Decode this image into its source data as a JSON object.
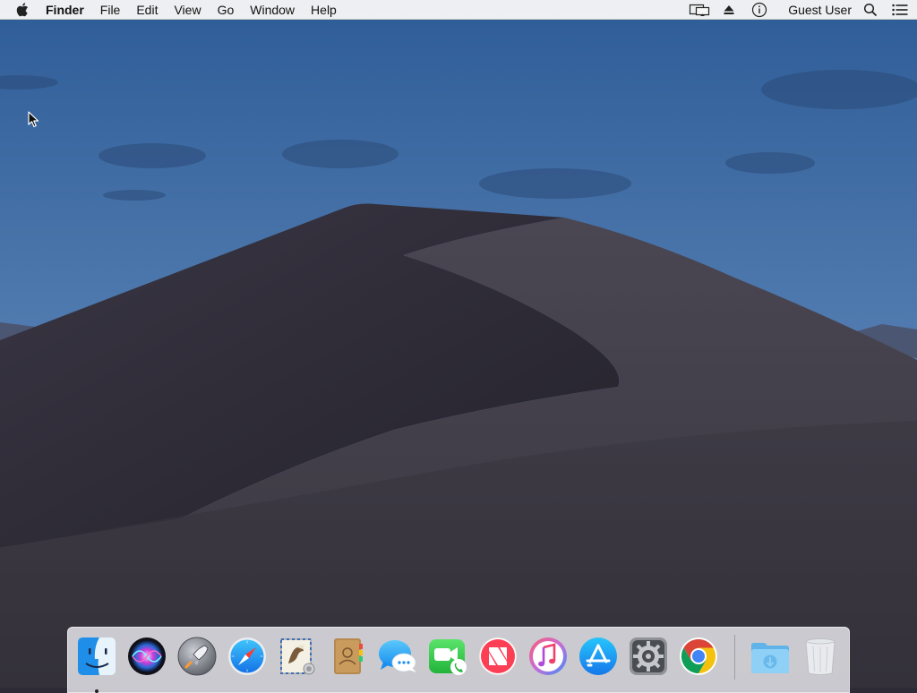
{
  "menubar": {
    "apple_icon": "apple-logo-icon",
    "app_name": "Finder",
    "menus": [
      "File",
      "Edit",
      "View",
      "Go",
      "Window",
      "Help"
    ],
    "status_icons": [
      "display-mirroring-icon",
      "eject-icon",
      "info-icon"
    ],
    "user": "Guest User",
    "right_icons": [
      "spotlight-search-icon",
      "notification-center-icon"
    ]
  },
  "dock": {
    "apps": [
      {
        "name": "Finder",
        "icon": "finder-icon",
        "running": true
      },
      {
        "name": "Siri",
        "icon": "siri-icon",
        "running": false
      },
      {
        "name": "Launchpad",
        "icon": "launchpad-icon",
        "running": false
      },
      {
        "name": "Safari",
        "icon": "safari-icon",
        "running": false
      },
      {
        "name": "Mail",
        "icon": "mail-icon",
        "running": false
      },
      {
        "name": "Contacts",
        "icon": "contacts-icon",
        "running": false
      },
      {
        "name": "Messages",
        "icon": "messages-icon",
        "running": false
      },
      {
        "name": "FaceTime",
        "icon": "facetime-icon",
        "running": false
      },
      {
        "name": "News",
        "icon": "news-icon",
        "running": false
      },
      {
        "name": "iTunes",
        "icon": "itunes-icon",
        "running": false
      },
      {
        "name": "App Store",
        "icon": "app-store-icon",
        "running": false
      },
      {
        "name": "System Preferences",
        "icon": "system-preferences-icon",
        "running": false
      },
      {
        "name": "Google Chrome",
        "icon": "chrome-icon",
        "running": false
      }
    ],
    "others": [
      {
        "name": "Downloads",
        "icon": "downloads-folder-icon"
      },
      {
        "name": "Trash",
        "icon": "trash-icon"
      }
    ]
  },
  "wallpaper": "Mojave dune at dusk",
  "colors": {
    "sky_top": "#2f5f9a",
    "sky_horizon": "#6a90bf",
    "dune": "#35323d",
    "menubar": "#f6f6f6"
  }
}
